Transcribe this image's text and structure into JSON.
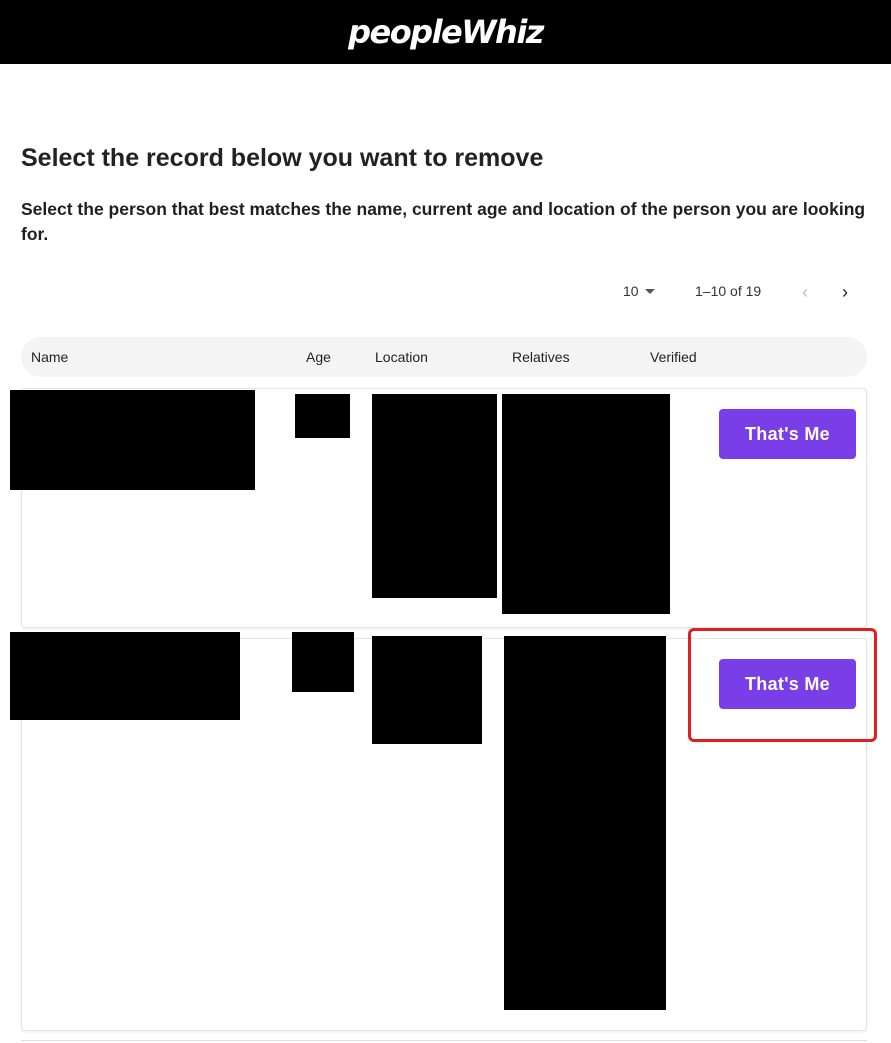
{
  "header": {
    "logo_text": "peopleWhiz",
    "background": "#000000"
  },
  "page": {
    "title": "Select the record below you want to remove",
    "subtitle": "Select the person that best matches the name, current age and location of the person you are looking for."
  },
  "pagination": {
    "per_page": "10",
    "range": "1–10 of 19",
    "prev_icon": "chevron-left-icon",
    "next_icon": "chevron-right-icon"
  },
  "table": {
    "columns": [
      "Name",
      "Age",
      "Location",
      "Relatives",
      "Verified"
    ]
  },
  "rows": [
    {
      "name": "[redacted]",
      "age": "[redacted]",
      "location": "[redacted]",
      "relatives": "[redacted]",
      "action_label": "That's Me"
    },
    {
      "name": "[redacted]",
      "age": "[redacted]",
      "location": "[redacted]",
      "relatives": "[redacted]",
      "action_label": "That's Me",
      "highlighted": true
    }
  ],
  "colors": {
    "button": "#7a3ee8",
    "highlight": "#e02020"
  }
}
